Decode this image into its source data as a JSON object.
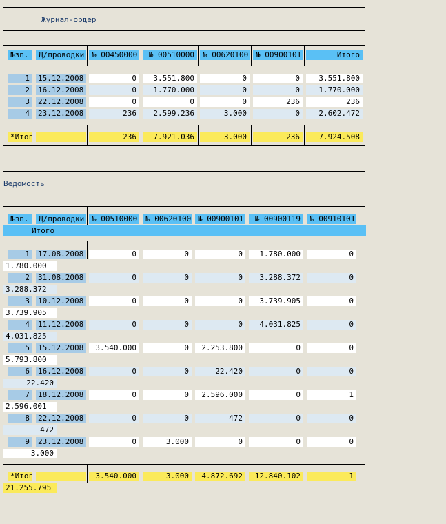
{
  "journal": {
    "title": "Журнал-ордер",
    "columns": [
      "№зп.",
      "Д/проводки",
      "№ 00450000",
      "№ 00510000",
      "№ 00620100",
      "№ 00900101",
      "Итого"
    ],
    "rows": [
      [
        "1",
        "15.12.2008",
        "0",
        "3.551.800",
        "0",
        "0",
        "3.551.800"
      ],
      [
        "2",
        "16.12.2008",
        "0",
        "1.770.000",
        "0",
        "0",
        "1.770.000"
      ],
      [
        "3",
        "22.12.2008",
        "0",
        "0",
        "0",
        "236",
        "236"
      ],
      [
        "4",
        "23.12.2008",
        "236",
        "2.599.236",
        "3.000",
        "0",
        "2.602.472"
      ]
    ],
    "total": [
      "*Итог",
      "",
      "236",
      "7.921.036",
      "3.000",
      "236",
      "7.924.508"
    ]
  },
  "statement": {
    "title": "Ведомость",
    "columns": [
      "№зп.",
      "Д/проводки",
      "№ 00510000",
      "№ 00620100",
      "№ 00900101",
      "№ 00900119",
      "№ 00910101"
    ],
    "total_column": "Итого",
    "rows": [
      [
        "1",
        "17.08.2008",
        "0",
        "0",
        "0",
        "1.780.000",
        "0",
        "1.780.000"
      ],
      [
        "2",
        "31.08.2008",
        "0",
        "0",
        "0",
        "3.288.372",
        "0",
        "3.288.372"
      ],
      [
        "3",
        "10.12.2008",
        "0",
        "0",
        "0",
        "3.739.905",
        "0",
        "3.739.905"
      ],
      [
        "4",
        "11.12.2008",
        "0",
        "0",
        "0",
        "4.031.825",
        "0",
        "4.031.825"
      ],
      [
        "5",
        "15.12.2008",
        "3.540.000",
        "0",
        "2.253.800",
        "0",
        "0",
        "5.793.800"
      ],
      [
        "6",
        "16.12.2008",
        "0",
        "0",
        "22.420",
        "0",
        "0",
        "22.420"
      ],
      [
        "7",
        "18.12.2008",
        "0",
        "0",
        "2.596.000",
        "0",
        "1",
        "2.596.001"
      ],
      [
        "8",
        "22.12.2008",
        "0",
        "0",
        "472",
        "0",
        "0",
        "472"
      ],
      [
        "9",
        "23.12.2008",
        "0",
        "3.000",
        "0",
        "0",
        "0",
        "3.000"
      ]
    ],
    "total": [
      "*Итог",
      "",
      "3.540.000",
      "3.000",
      "4.872.692",
      "12.840.102",
      "1",
      "21.255.795"
    ]
  },
  "colors": {
    "background": "#e6e3d8",
    "header": "#5ac0f5",
    "key_cell": "#a7cbe6",
    "row_white": "#ffffff",
    "row_blue": "#dde9f2",
    "total": "#fbea5a",
    "title_text": "#1a3a6a"
  }
}
